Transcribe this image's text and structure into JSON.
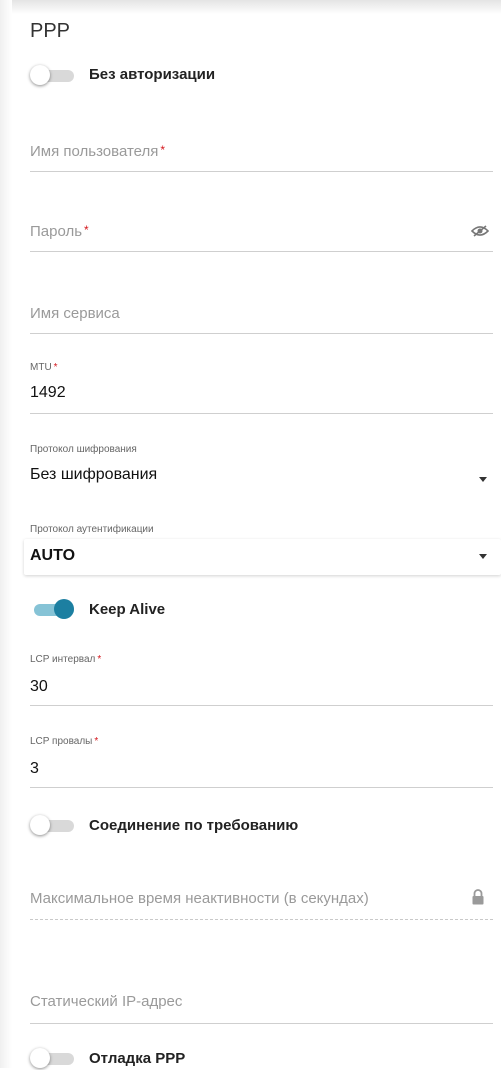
{
  "section_title": "PPP",
  "no_auth": {
    "label": "Без авторизации",
    "on": false
  },
  "username": {
    "placeholder": "Имя пользователя",
    "required": "*"
  },
  "password": {
    "placeholder": "Пароль",
    "required": "*",
    "icon": "eye-slash-icon"
  },
  "service_name": {
    "placeholder": "Имя сервиса"
  },
  "mtu": {
    "label": "MTU",
    "required": "*",
    "value": "1492"
  },
  "encryption": {
    "label": "Протокол шифрования",
    "value": "Без шифрования"
  },
  "auth_protocol": {
    "label": "Протокол аутентификации",
    "value": "AUTO"
  },
  "keep_alive": {
    "label": "Keep Alive",
    "on": true
  },
  "lcp_interval": {
    "label": "LCP интервал",
    "required": "*",
    "value": "30"
  },
  "lcp_failures": {
    "label": "LCP провалы",
    "required": "*",
    "value": "3"
  },
  "on_demand": {
    "label": "Соединение по требованию",
    "on": false
  },
  "max_idle": {
    "placeholder": "Максимальное время неактивности (в секундах)",
    "icon": "lock-icon"
  },
  "static_ip": {
    "placeholder": "Статический IP-адрес"
  },
  "ppp_debug": {
    "label": "Отладка PPP",
    "on": false
  },
  "colors": {
    "accent": "#1c7fa1",
    "accent_track": "#86c3d6",
    "required": "#d4161c"
  }
}
